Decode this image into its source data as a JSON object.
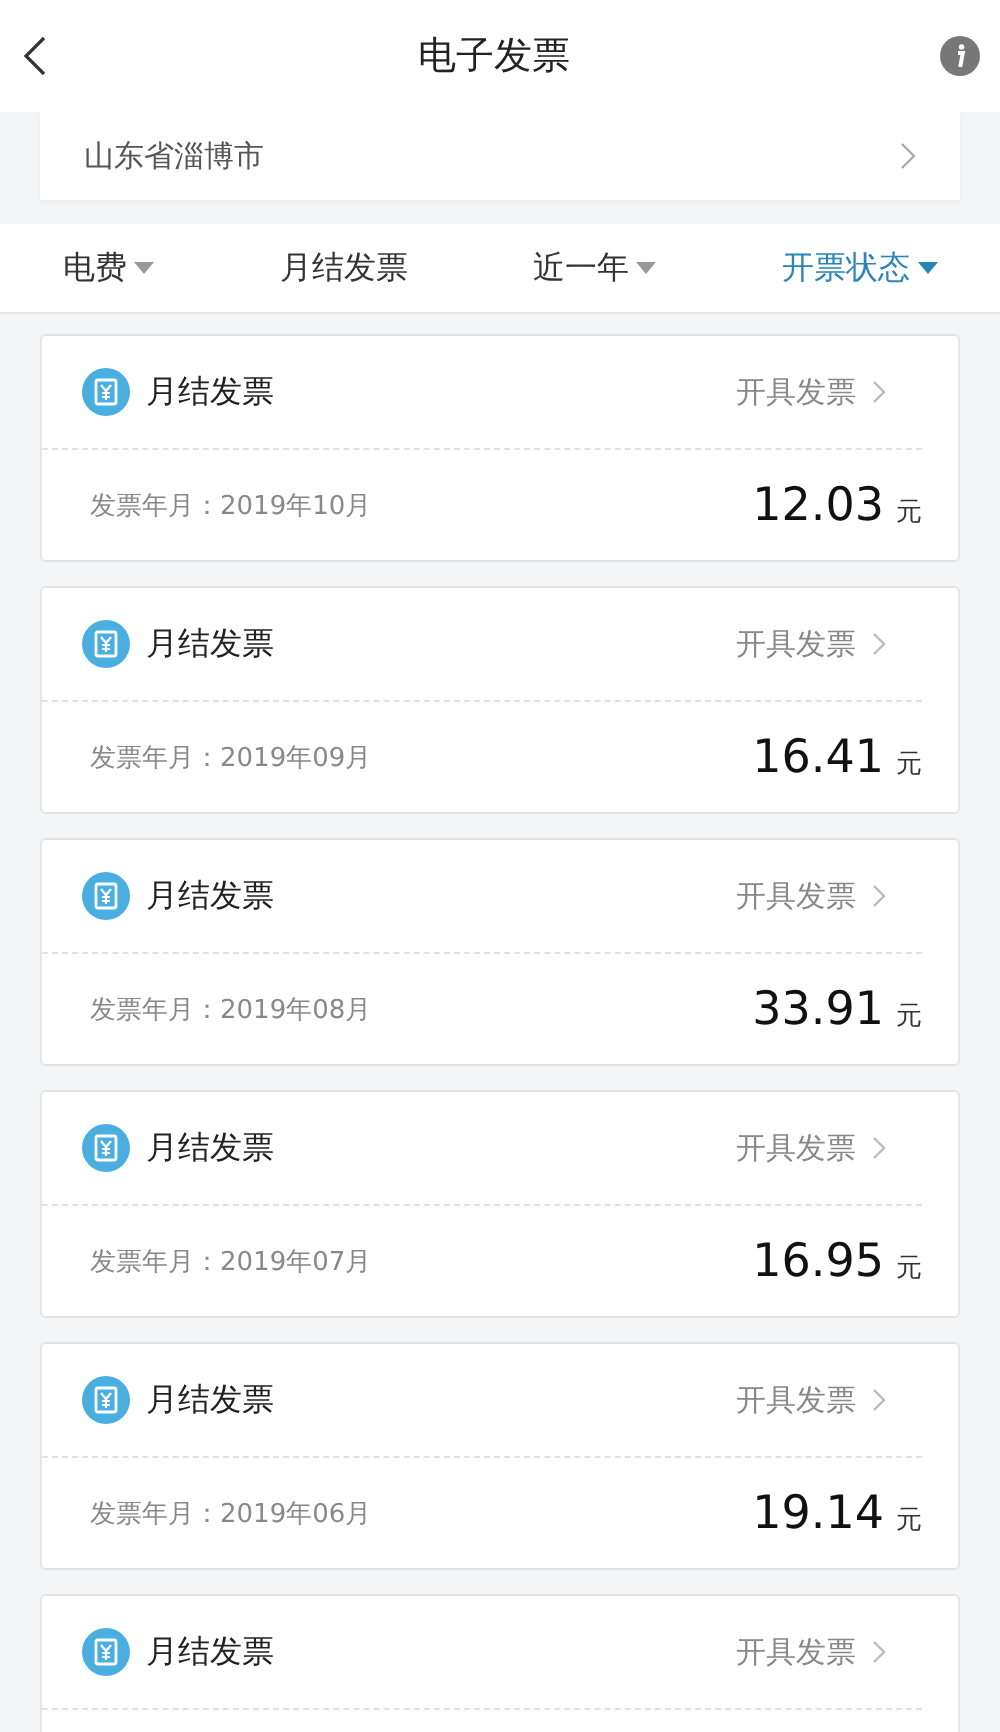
{
  "header": {
    "title": "电子发票"
  },
  "account": {
    "address": "山东省淄博市"
  },
  "filters": [
    {
      "label": "电费",
      "kind": "dropdown",
      "selected": false
    },
    {
      "label": "月结发票",
      "kind": "plain",
      "selected": false
    },
    {
      "label": "近一年",
      "kind": "dropdown",
      "selected": false
    },
    {
      "label": "开票状态",
      "kind": "dropdown",
      "selected": true
    }
  ],
  "invoices": [
    {
      "type": "月结发票",
      "action": "开具发票",
      "period_label": "发票年月：2019年10月",
      "amount": "12.03",
      "unit": "元"
    },
    {
      "type": "月结发票",
      "action": "开具发票",
      "period_label": "发票年月：2019年09月",
      "amount": "16.41",
      "unit": "元"
    },
    {
      "type": "月结发票",
      "action": "开具发票",
      "period_label": "发票年月：2019年08月",
      "amount": "33.91",
      "unit": "元"
    },
    {
      "type": "月结发票",
      "action": "开具发票",
      "period_label": "发票年月：2019年07月",
      "amount": "16.95",
      "unit": "元"
    },
    {
      "type": "月结发票",
      "action": "开具发票",
      "period_label": "发票年月：2019年06月",
      "amount": "19.14",
      "unit": "元"
    },
    {
      "type": "月结发票",
      "action": "开具发票"
    }
  ]
}
